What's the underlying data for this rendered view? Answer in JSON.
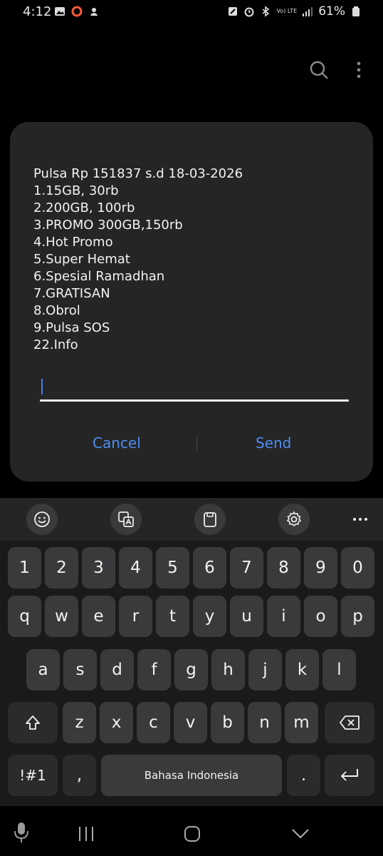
{
  "status": {
    "time": "4:12",
    "battery": "61%",
    "network": "Vo) LTE"
  },
  "dialog": {
    "lines": [
      "Pulsa Rp 151837 s.d 18-03-2026",
      "1.15GB, 30rb",
      "2.200GB, 100rb",
      "3.PROMO 300GB,150rb",
      "4.Hot Promo",
      "5.Super Hemat",
      "6.Spesial Ramadhan",
      "7.GRATISAN",
      "8.Obrol",
      "9.Pulsa SOS",
      "22.Info"
    ],
    "input_value": "",
    "cancel_label": "Cancel",
    "send_label": "Send"
  },
  "keyboard": {
    "numbers": [
      "1",
      "2",
      "3",
      "4",
      "5",
      "6",
      "7",
      "8",
      "9",
      "0"
    ],
    "row1": [
      "q",
      "w",
      "e",
      "r",
      "t",
      "y",
      "u",
      "i",
      "o",
      "p"
    ],
    "row2": [
      "a",
      "s",
      "d",
      "f",
      "g",
      "h",
      "j",
      "k",
      "l"
    ],
    "row3": [
      "z",
      "x",
      "c",
      "v",
      "b",
      "n",
      "m"
    ],
    "symbols_label": "!#1",
    "comma": ",",
    "space_label": "Bahasa Indonesia",
    "period": "."
  },
  "colors": {
    "accent": "#4e8ef0",
    "dialog_bg": "#252526",
    "key_bg": "#3a3a3c"
  },
  "icons": [
    "search-icon",
    "more-vert-icon",
    "emoji-icon",
    "translate-icon",
    "clipboard-icon",
    "settings-icon",
    "more-horiz-icon",
    "shift-icon",
    "backspace-icon",
    "enter-icon",
    "mic-icon",
    "recents-icon",
    "home-icon",
    "back-icon"
  ]
}
